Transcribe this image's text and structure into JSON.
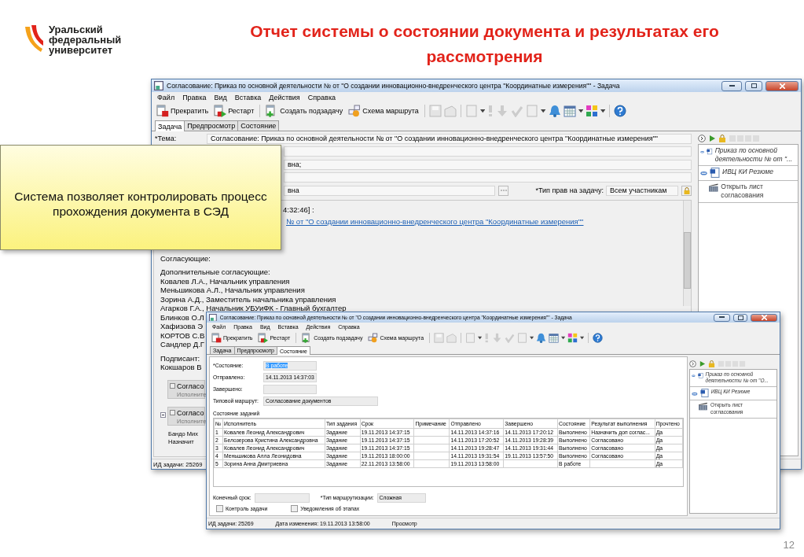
{
  "logo": {
    "lines": [
      "Уральский",
      "федеральный",
      "университет"
    ]
  },
  "title": "Отчет системы о состоянии документа и результатах его рассмотрения",
  "callout": "Система позволяет контролировать процесс прохождения документа в СЭД",
  "page_number": "12",
  "back_window": {
    "title": "Согласование: Приказ по основной деятельности №  от  \"О создании инновационно-внедренческого центра \"Координатные измерения\"\" - Задача",
    "menu": [
      "Файл",
      "Правка",
      "Вид",
      "Вставка",
      "Действия",
      "Справка"
    ],
    "toolbar": [
      {
        "kind": "stop",
        "label": "Прекратить"
      },
      {
        "kind": "restart",
        "label": "Рестарт"
      },
      {
        "kind": "subtask",
        "label": "Создать подзадачу"
      },
      {
        "kind": "route",
        "label": "Схема маршрута"
      }
    ],
    "tabs": [
      {
        "label": "Задача",
        "selected": true
      },
      {
        "label": "Предпросмотр",
        "selected": false
      },
      {
        "label": "Состояние",
        "selected": false
      }
    ],
    "subject": {
      "label": "*Тема:",
      "value": "Согласование: Приказ по основной деятельности №  от  \"О создании инновационно-внедренческого центра \"Координатные измерения\"\""
    },
    "field_3": "вна;",
    "field_5": "вна",
    "rights": {
      "label": "*Тип прав на задачу:",
      "value": "Всем участникам"
    },
    "body": {
      "timestamp": "4:32:46] :",
      "link": "№  от  \"О создании инновационно-внедренческого центра \"Координатные измерения\"\"",
      "paragraphs": [
        [
          "Согласующие:"
        ],
        [
          "Дополнительные согласующие:",
          "Ковалев Л.А., Начальник управления",
          "Меньшикова А.Л., Начальник управления",
          "Зорина А.Д., Заместитель начальника управления",
          "Агарков Г.А., Начальник УБУиФК - Главный бухгалтер",
          "Блинков О.Л",
          "Хафизова Э",
          "КОРТОВ С.В",
          "Сандлер Д.Г"
        ],
        [
          "Подписант:",
          "Кокшаров В"
        ]
      ],
      "groups": [
        {
          "title": "Согласо",
          "subtitle": "Исполните",
          "expanded": false
        },
        {
          "title": "Согласо",
          "subtitle": "Исполните",
          "expanded": true
        }
      ],
      "notes": [
        "Бандо Мих",
        "Назначит"
      ]
    },
    "attachments": [
      {
        "kind": "document",
        "title": "Приказ по основной деятельности № от \"..."
      },
      {
        "kind": "document",
        "title": "ИВЦ КИ Резюме"
      },
      {
        "kind": "sheet",
        "title": "Открыть лист согласования"
      }
    ],
    "status": "ИД задачи: 25269"
  },
  "front_window": {
    "title": "Согласование: Приказ по основной деятельности №  от  \"О создании инновационно-внедренческого центра \"Координатные измерения\"\" - Задача",
    "menu": [
      "Файл",
      "Правка",
      "Вид",
      "Вставка",
      "Действия",
      "Справка"
    ],
    "toolbar": [
      {
        "kind": "stop",
        "label": "Прекратить"
      },
      {
        "kind": "restart",
        "label": "Рестарт"
      },
      {
        "kind": "subtask",
        "label": "Создать подзадачу"
      },
      {
        "kind": "route",
        "label": "Схема маршрута"
      }
    ],
    "tabs": [
      {
        "label": "Задача",
        "selected": false
      },
      {
        "label": "Предпросмотр",
        "selected": false
      },
      {
        "label": "Состояние",
        "selected": true
      }
    ],
    "state": {
      "label": "*Состояние:",
      "value": "В работе",
      "highlighted": true
    },
    "sent": {
      "label": "Отправлено:",
      "value": "14.11.2013 14:37:03"
    },
    "finished": {
      "label": "Завершено:"
    },
    "route": {
      "label": "Типовой маршрут:",
      "value": "Согласование документов"
    },
    "tasks_label": "Состояние заданий",
    "table": {
      "columns": [
        "№",
        "Исполнитель",
        "Тип задания",
        "Срок",
        "Примечание",
        "Отправлено",
        "Завершено",
        "Состояние",
        "Результат выполнения",
        "Прочтено"
      ],
      "rows": [
        [
          "1",
          "Ковалев Леонид Александрович",
          "Задание",
          "19.11.2013 14:37:15",
          "",
          "14.11.2013 14:37:16",
          "14.11.2013 17:20:12",
          "Выполнено",
          "Назначить доп соглас...",
          "Да"
        ],
        [
          "2",
          "Белозерова Кристина Александровна",
          "Задание",
          "19.11.2013 14:37:15",
          "",
          "14.11.2013 17:20:52",
          "14.11.2013 19:28:39",
          "Выполнено",
          "Согласовано",
          "Да"
        ],
        [
          "3",
          "Ковалев Леонид Александрович",
          "Задание",
          "19.11.2013 14:37:15",
          "",
          "14.11.2013 19:28:47",
          "14.11.2013 19:31:44",
          "Выполнено",
          "Согласовано",
          "Да"
        ],
        [
          "4",
          "Меньшикова Алла Леонидовна",
          "Задание",
          "19.11.2013 18:00:00",
          "",
          "14.11.2013 19:31:54",
          "19.11.2013 13:57:50",
          "Выполнено",
          "Согласовано",
          "Да"
        ],
        [
          "5",
          "Зорина Анна Дмитриевна",
          "Задание",
          "22.11.2013 13:58:00",
          "",
          "19.11.2013 13:58:00",
          "",
          "В работе",
          "",
          "Да"
        ]
      ]
    },
    "deadline": {
      "label": "Конечный срок:"
    },
    "routing": {
      "label": "*Тип маршрутизации:",
      "value": "Сложная"
    },
    "checkboxes": [
      {
        "label": "Контроль задачи",
        "checked": false
      },
      {
        "label": "Уведомления об этапах",
        "checked": false
      }
    ],
    "attachments": [
      {
        "kind": "document",
        "title": "Приказ по основной деятельности № от \"О..."
      },
      {
        "kind": "document",
        "title": "ИВЦ КИ Резюме"
      },
      {
        "kind": "sheet",
        "title": "Открыть лист согласования"
      }
    ],
    "status": [
      "ИД задачи: 25269",
      "Дата изменения: 19.11.2013 13:58:00",
      "Просмотр"
    ]
  }
}
